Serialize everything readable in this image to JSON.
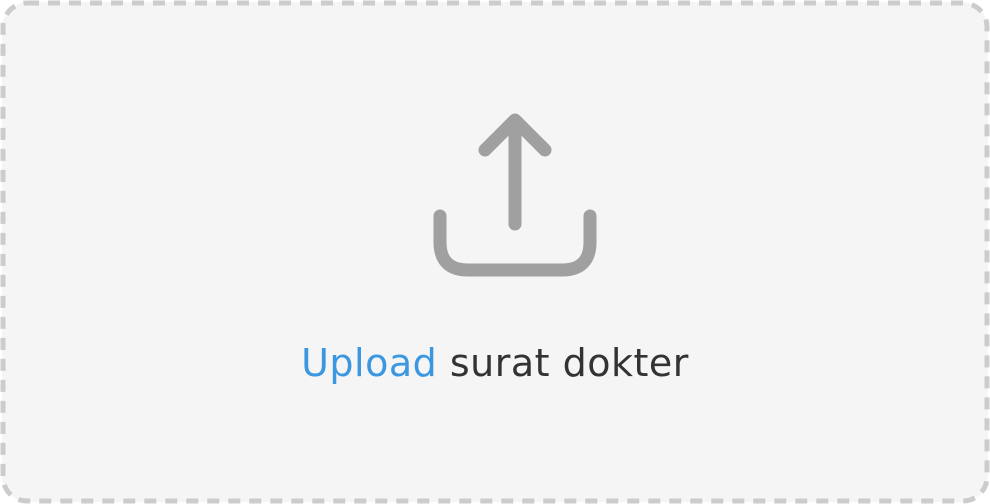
{
  "upload": {
    "link_label": "Upload",
    "rest_label": "surat dokter",
    "icon": "upload-icon"
  },
  "colors": {
    "link": "#3b97e0",
    "text": "#333333",
    "icon": "#a0a0a0",
    "background": "#f5f5f5",
    "border": "#cccccc"
  }
}
